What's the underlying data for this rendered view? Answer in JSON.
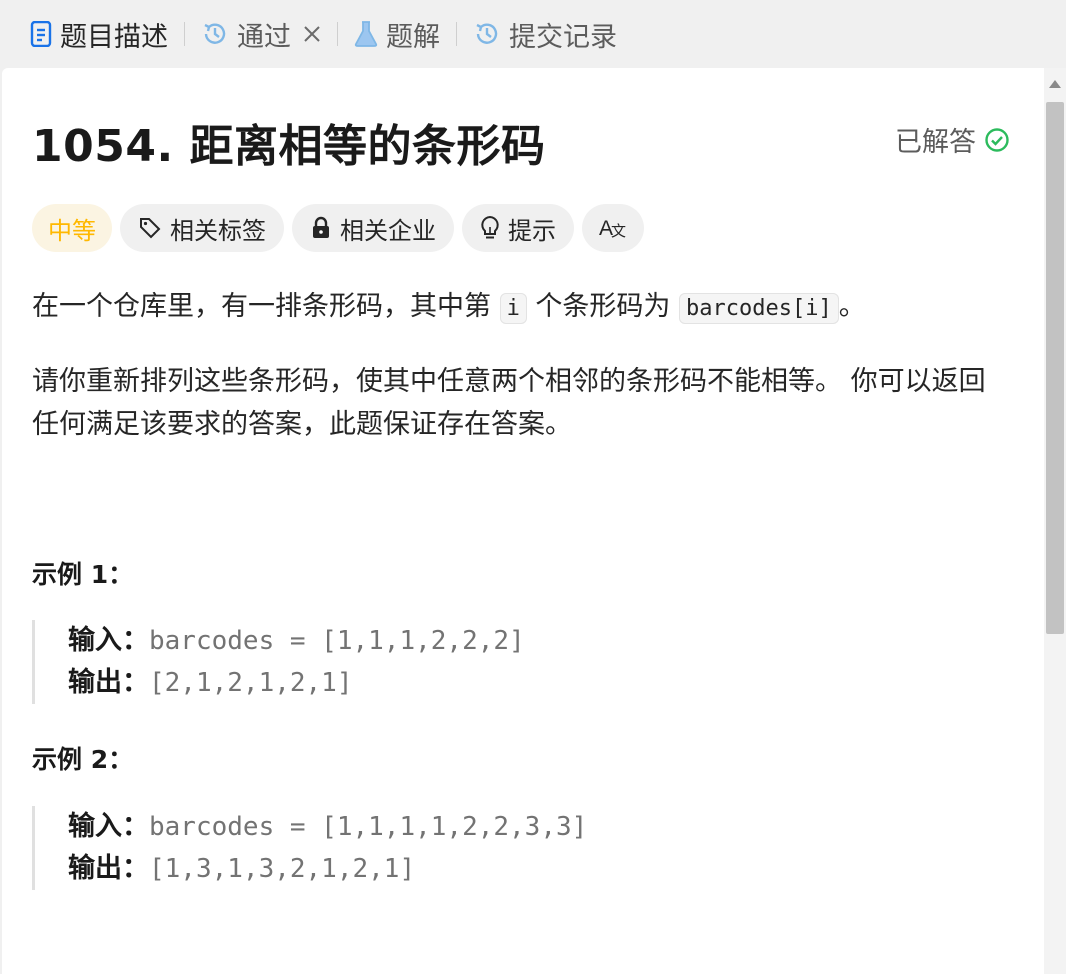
{
  "tabs": [
    {
      "label": "题目描述",
      "icon": "document-icon",
      "active": true
    },
    {
      "label": "通过",
      "icon": "history-icon",
      "closable": true
    },
    {
      "label": "题解",
      "icon": "flask-icon"
    },
    {
      "label": "提交记录",
      "icon": "history-icon"
    }
  ],
  "problem": {
    "title": "1054. 距离相等的条形码",
    "status": "已解答",
    "difficulty": "中等",
    "chips": [
      "相关标签",
      "相关企业",
      "提示"
    ]
  },
  "description": {
    "p1_before": "在一个仓库里，有一排条形码，其中第 ",
    "p1_code1": "i",
    "p1_middle": " 个条形码为 ",
    "p1_code2": "barcodes[i]",
    "p1_after": "。",
    "p2": "请你重新排列这些条形码，使其中任意两个相邻的条形码不能相等。 你可以返回任何满足该要求的答案，此题保证存在答案。"
  },
  "examples": [
    {
      "title": "示例 1：",
      "input_label": "输入：",
      "input": "barcodes = [1,1,1,2,2,2]",
      "output_label": "输出：",
      "output": "[2,1,2,1,2,1]"
    },
    {
      "title": "示例 2：",
      "input_label": "输入：",
      "input": "barcodes = [1,1,1,1,2,2,3,3]",
      "output_label": "输出：",
      "output": "[1,3,1,3,2,1,2,1]"
    }
  ],
  "colors": {
    "difficulty": "#ffb800",
    "solved": "#2cbb5d",
    "history_icon": "#7fb7e6"
  }
}
